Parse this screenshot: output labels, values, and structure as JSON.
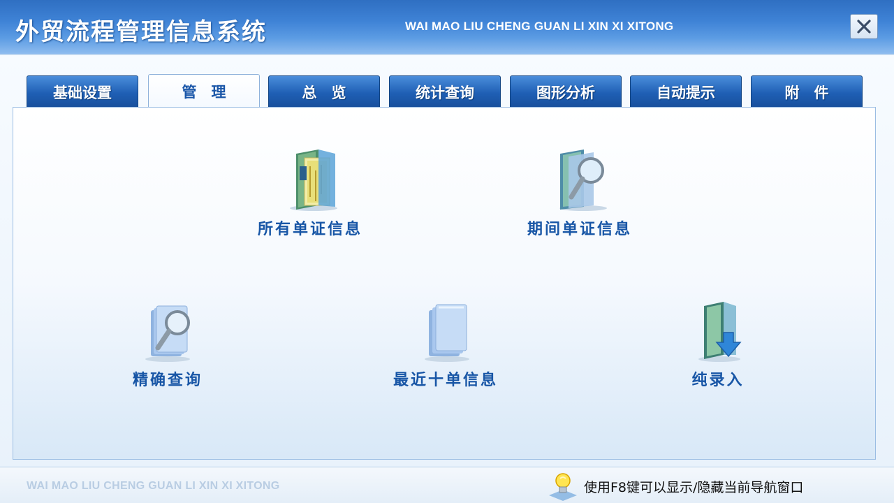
{
  "app": {
    "title_cn": "外贸流程管理信息系统",
    "title_en": "WAI MAO LIU CHENG GUAN LI XIN XI XITONG"
  },
  "tabs": [
    {
      "label": "基础设置",
      "active": false
    },
    {
      "label": "管　理",
      "active": true
    },
    {
      "label": "总　览",
      "active": false
    },
    {
      "label": "统计查询",
      "active": false
    },
    {
      "label": "图形分析",
      "active": false
    },
    {
      "label": "自动提示",
      "active": false
    },
    {
      "label": "附　件",
      "active": false
    }
  ],
  "launchers": [
    {
      "label": "所有单证信息",
      "icon": "folder-documents-icon"
    },
    {
      "label": "期间单证信息",
      "icon": "folder-search-icon"
    },
    {
      "label": "精确查询",
      "icon": "pages-search-icon"
    },
    {
      "label": "最近十单信息",
      "icon": "pages-stack-icon"
    },
    {
      "label": "纯录入",
      "icon": "folder-download-icon"
    }
  ],
  "footer": {
    "title_en": "WAI MAO LIU CHENG GUAN LI XIN XI XITONG",
    "hint": "使用F8键可以显示/隐藏当前导航窗口",
    "hint_icon": "lightbulb-icon"
  },
  "colors": {
    "titlebar": "#3f83d6",
    "tab_blue": "#1f5fb4",
    "label_blue": "#1856a6"
  }
}
